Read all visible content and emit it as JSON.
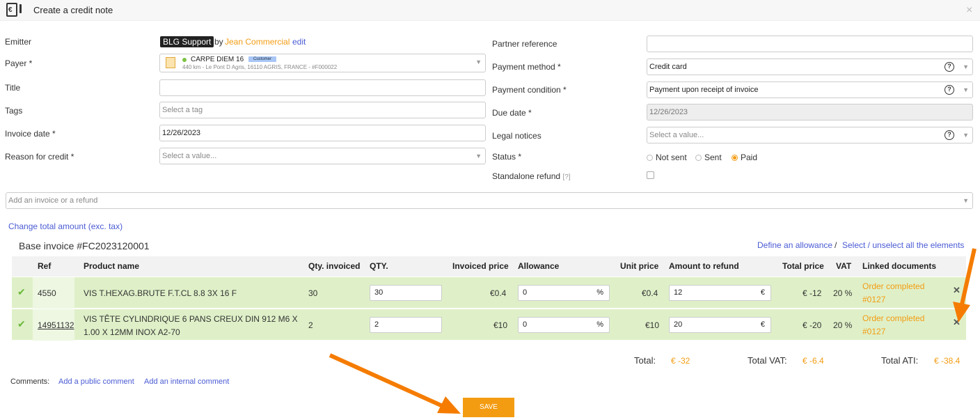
{
  "header": {
    "title": "Create a credit note",
    "close": "×",
    "icon_glyph": "€"
  },
  "left_form": {
    "emitter_label": "Emitter",
    "emitter_company": "BLG Support",
    "emitter_by": "by",
    "emitter_person": "Jean Commercial",
    "emitter_edit": "edit",
    "payer_label": "Payer *",
    "payer_name": "CARPE DIEM 16",
    "payer_badge": "Customer",
    "payer_address": "440 km - Le Pont D Agris, 16110 AGRIS, FRANCE - #F000022",
    "title_label": "Title",
    "title_value": "",
    "tags_label": "Tags",
    "tags_placeholder": "Select a tag",
    "invoice_date_label": "Invoice date *",
    "invoice_date_value": "12/26/2023",
    "reason_label": "Reason for credit *",
    "reason_placeholder": "Select a value..."
  },
  "right_form": {
    "partner_ref_label": "Partner reference",
    "partner_ref_value": "",
    "payment_method_label": "Payment method *",
    "payment_method_value": "Credit card",
    "payment_condition_label": "Payment condition *",
    "payment_condition_value": "Payment upon receipt of invoice",
    "due_date_label": "Due date *",
    "due_date_value": "12/26/2023",
    "legal_notices_label": "Legal notices",
    "legal_notices_placeholder": "Select a value...",
    "status_label": "Status *",
    "status_options": [
      "Not sent",
      "Sent",
      "Paid"
    ],
    "status_selected": "Paid",
    "standalone_label": "Standalone refund",
    "standalone_hint": "[?]",
    "standalone_checked": false
  },
  "add_invoice_placeholder": "Add an invoice or a refund",
  "change_total_link": "Change total amount (exc. tax)",
  "base_invoice_title": "Base invoice #FC2023120001",
  "define_allowance_link": "Define an allowance",
  "separator": "/",
  "select_all_link": "Select / unselect all the elements",
  "table": {
    "columns": [
      "Ref",
      "Product name",
      "Qty. invoiced",
      "QTY.",
      "Invoiced price",
      "Allowance",
      "Unit price",
      "Amount to refund",
      "Total price",
      "VAT",
      "Linked documents"
    ],
    "rows": [
      {
        "ref": "4550",
        "product": "VIS T.HEXAG.BRUTE F.T.CL 8.8 3X 16 F",
        "product_line2": "",
        "qty_invoiced": "30",
        "qty": "30",
        "invoiced_price": "€0.4",
        "allowance": "0",
        "allowance_unit": "%",
        "unit_price": "€0.4",
        "amount_refund": "12",
        "amount_unit": "€",
        "total_price": "€ -12",
        "vat": "20 %",
        "linked_line1": "Order completed",
        "linked_line2": "#0127"
      },
      {
        "ref": "14951132",
        "product": "VIS TÊTE CYLINDRIQUE 6 PANS CREUX DIN 912 M6 X",
        "product_line2": "1.00 X 12MM INOX A2-70",
        "qty_invoiced": "2",
        "qty": "2",
        "invoiced_price": "€10",
        "allowance": "0",
        "allowance_unit": "%",
        "unit_price": "€10",
        "amount_refund": "20",
        "amount_unit": "€",
        "total_price": "€ -20",
        "vat": "20 %",
        "linked_line1": "Order completed",
        "linked_line2": "#0127"
      }
    ]
  },
  "totals": {
    "total_label": "Total:",
    "total_value": "€ -32",
    "vat_label": "Total VAT:",
    "vat_value": "€ -6.4",
    "ati_label": "Total ATI:",
    "ati_value": "€ -38.4"
  },
  "comments": {
    "label": "Comments:",
    "public": "Add a public comment",
    "internal": "Add an internal comment"
  },
  "save_label": "SAVE",
  "colors": {
    "accent": "#f39c12",
    "link": "#4a5bd4",
    "row_bg": "#dff0c8",
    "arrow": "#f57c00"
  }
}
